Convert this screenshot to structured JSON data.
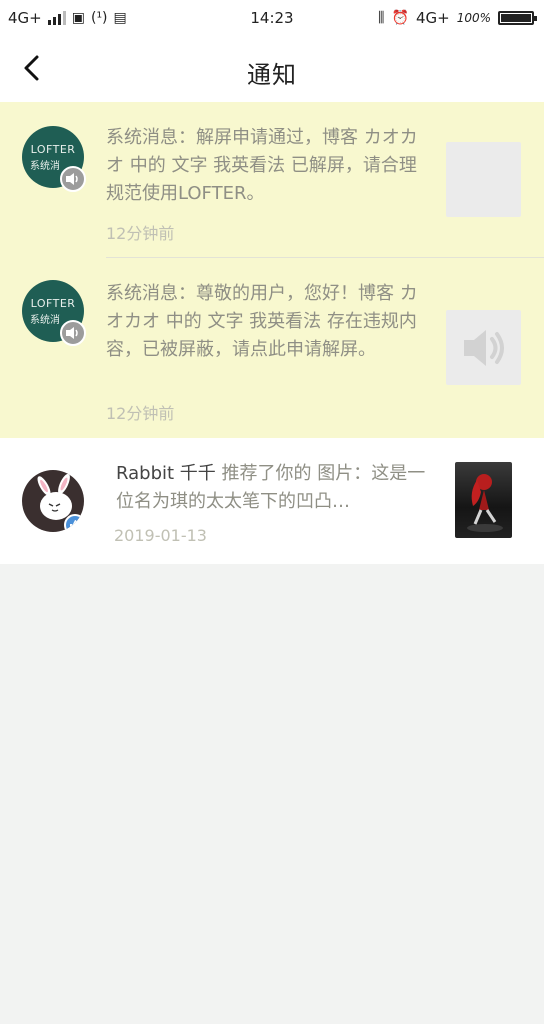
{
  "status_bar": {
    "left_network": "4G+",
    "nfc_label": "(¹)",
    "time": "14:23",
    "right_network": "4G+",
    "battery_percent": "100%"
  },
  "nav": {
    "title": "通知"
  },
  "notifications": [
    {
      "avatar_brand": "LOFTER",
      "avatar_sub": "系统消",
      "text": "系统消息：解屏申请通过，博客 カオカオ 中的 文字 我英看法 已解屏，请合理规范使用LOFTER。",
      "time": "12分钟前",
      "unread": true,
      "thumb": "gray"
    },
    {
      "avatar_brand": "LOFTER",
      "avatar_sub": "系统消",
      "text": "系统消息：尊敬的用户，您好！博客 カオカオ 中的 文字 我英看法 存在违规内容，已被屏蔽，请点此申请解屏。",
      "time": "12分钟前",
      "unread": true,
      "thumb": "speaker-icon"
    },
    {
      "username": "Rabbit 千千",
      "text": " 推荐了你的 图片：这是一位名为琪的太太笔下的凹凸…",
      "time": "2019-01-13",
      "unread": false,
      "thumb": "photo"
    }
  ],
  "colors": {
    "unread_bg": "#f8f8cf",
    "read_bg": "#ffffff",
    "page_bg": "#f2f3f2",
    "lofter_green": "#1f5e54",
    "like_blue": "#4a90d9"
  }
}
